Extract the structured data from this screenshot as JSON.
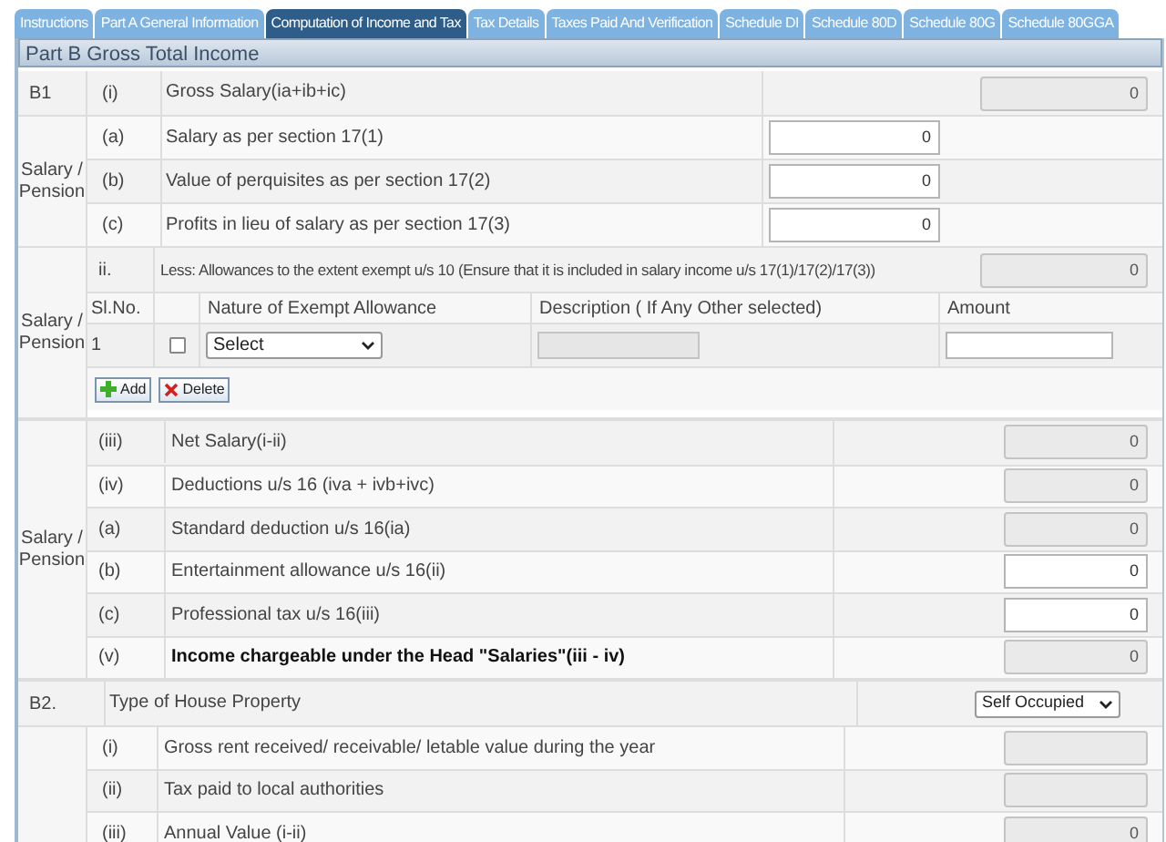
{
  "tabs": [
    {
      "label": "Instructions",
      "selected": false
    },
    {
      "label": "Part A General Information",
      "selected": false
    },
    {
      "label": "Computation of Income and Tax",
      "selected": true
    },
    {
      "label": "Tax Details",
      "selected": false
    },
    {
      "label": "Taxes Paid And Verification",
      "selected": false
    },
    {
      "label": "Schedule DI",
      "selected": false
    },
    {
      "label": "Schedule 80D",
      "selected": false
    },
    {
      "label": "Schedule 80G",
      "selected": false
    },
    {
      "label": "Schedule 80GGA",
      "selected": false
    }
  ],
  "section_title": "Part B Gross Total Income",
  "b1": {
    "code": "B1",
    "num": "(i)",
    "label": "Gross Salary(ia+ib+ic)",
    "value": "0",
    "disabled": true,
    "group_label": "Salary / Pension",
    "rows": [
      {
        "num": "(a)",
        "label": "Salary as per section 17(1)",
        "value": "0",
        "disabled": false
      },
      {
        "num": "(b)",
        "label": "Value of perquisites as per section 17(2)",
        "value": "0",
        "disabled": false
      },
      {
        "num": "(c)",
        "label": "Profits in lieu of salary as per section 17(3)",
        "value": "0",
        "disabled": false
      }
    ]
  },
  "exempt": {
    "group_label": "Salary / Pension",
    "num": "ii.",
    "label": "Less: Allowances to the extent exempt u/s 10 (Ensure that it is included in salary income u/s 17(1)/17(2)/17(3))",
    "value": "0",
    "columns": [
      "Sl.No.",
      "Nature of Exempt Allowance",
      "Description ( If Any Other selected)",
      "Amount"
    ],
    "rows": [
      {
        "sl": "1",
        "checked": false,
        "select": "Select"
      }
    ],
    "buttons": [
      {
        "label": "Add",
        "kind": "add"
      },
      {
        "label": "Delete",
        "kind": "delete"
      }
    ]
  },
  "net": {
    "group_label": "Salary / Pension",
    "rows": [
      {
        "num": "(iii)",
        "label": "Net Salary(i-ii)",
        "value": "0",
        "disabled": true,
        "bold": false
      },
      {
        "num": "(iv)",
        "label": "Deductions u/s 16 (iva + ivb+ivc)",
        "value": "0",
        "disabled": true,
        "bold": false
      },
      {
        "num": "(a)",
        "label": "Standard deduction u/s 16(ia)",
        "value": "0",
        "disabled": true,
        "bold": false
      },
      {
        "num": "(b)",
        "label": "Entertainment allowance u/s 16(ii)",
        "value": "0",
        "disabled": false,
        "bold": false
      },
      {
        "num": "(c)",
        "label": "Professional tax u/s 16(iii)",
        "value": "0",
        "disabled": false,
        "bold": false
      },
      {
        "num": "(v)",
        "label": "Income chargeable under the Head \"Salaries\"(iii - iv)",
        "value": "0",
        "disabled": true,
        "bold": true
      }
    ]
  },
  "b2": {
    "code": "B2.",
    "label": "Type of House Property",
    "select": "Self Occupied",
    "rows": [
      {
        "num": "(i)",
        "label": "Gross rent received/ receivable/ letable value during the year",
        "disabled": true
      },
      {
        "num": "(ii)",
        "label": "Tax paid to local authorities",
        "disabled": true
      },
      {
        "num": "(iii)",
        "label": "Annual Value (i-ii)",
        "value": "0",
        "disabled": true
      }
    ]
  }
}
